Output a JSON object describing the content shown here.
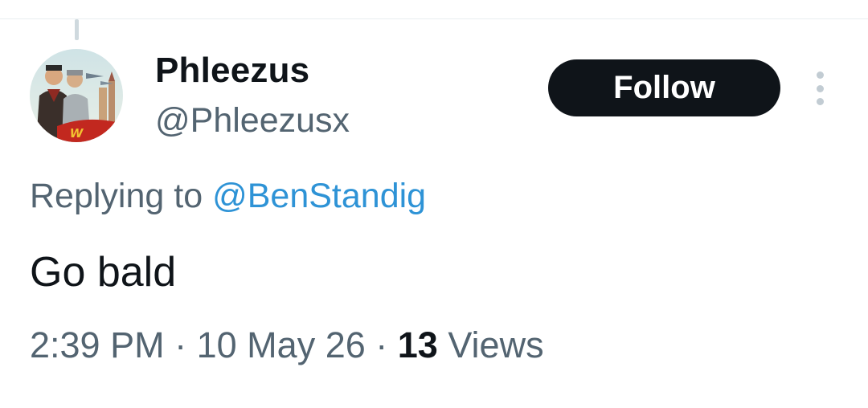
{
  "tweet": {
    "author": {
      "display_name": "Phleezus",
      "handle": "@Phleezusx",
      "avatar_icon": "profile-avatar"
    },
    "follow_label": "Follow",
    "more_icon": "more-options-icon",
    "replying_prefix": "Replying to",
    "replying_to": "@BenStandig",
    "text": "Go bald",
    "time": "2:39 PM",
    "separator": "·",
    "date": "10 May 26",
    "views_count": "13",
    "views_label": "Views"
  },
  "colors": {
    "text_primary": "#0f1419",
    "text_secondary": "#536471",
    "mention": "#2e93d6",
    "follow_bg": "#0f1419",
    "follow_text": "#ffffff"
  }
}
